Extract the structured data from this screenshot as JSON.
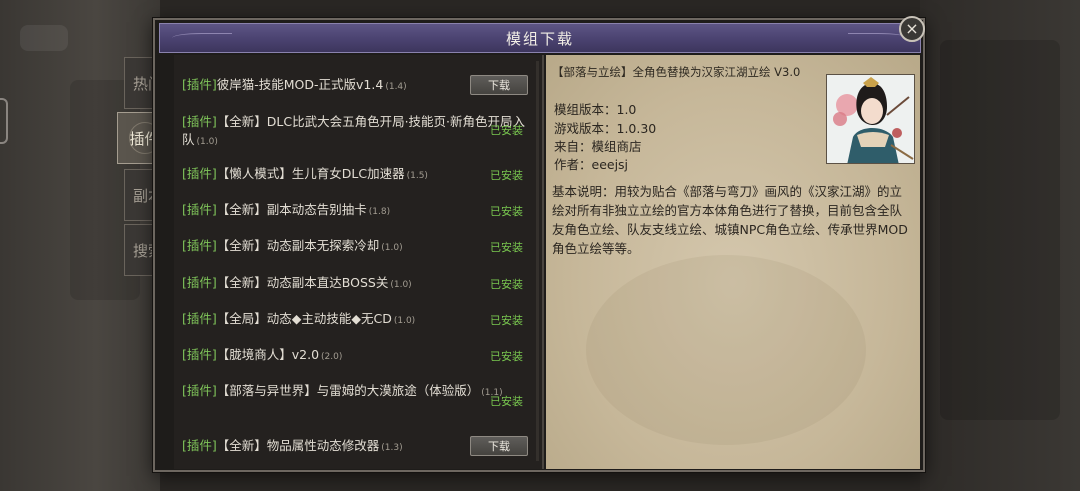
{
  "window": {
    "title": "模组下载",
    "close_glyph": "×"
  },
  "side_tabs": [
    {
      "label": "热门",
      "active": false
    },
    {
      "label": "插件",
      "active": true,
      "icon": "scroll-icon"
    },
    {
      "label": "副本",
      "active": false
    },
    {
      "label": "搜索",
      "active": false
    }
  ],
  "list": {
    "items": [
      {
        "tag": "[插件]",
        "name": "彼岸猫-技能MOD-正式版v1.4",
        "version": "(1.4)",
        "action": "下载"
      },
      {
        "tag": "[插件]",
        "name": "【全新】DLC比武大会五角色开局·技能页·新角色开局入队",
        "version": "(1.0)",
        "status": "已安装"
      },
      {
        "tag": "[插件]",
        "name": "【懒人模式】生儿育女DLC加速器",
        "version": "(1.5)",
        "status": "已安装"
      },
      {
        "tag": "[插件]",
        "name": "【全新】副本动态告别抽卡",
        "version": "(1.8)",
        "status": "已安装"
      },
      {
        "tag": "[插件]",
        "name": "【全新】动态副本无探索冷却",
        "version": "(1.0)",
        "status": "已安装"
      },
      {
        "tag": "[插件]",
        "name": "【全新】动态副本直达BOSS关",
        "version": "(1.0)",
        "status": "已安装"
      },
      {
        "tag": "[插件]",
        "name": "【全局】动态◆主动技能◆无CD",
        "version": "(1.0)",
        "status": "已安装"
      },
      {
        "tag": "[插件]",
        "name": "【胧境商人】v2.0",
        "version": "(2.0)",
        "status": "已安装"
      },
      {
        "tag": "[插件]",
        "name": "【部落与异世界】与雷姆的大漠旅途（体验版）",
        "version": "(1.1)",
        "status": "已安装"
      },
      {
        "tag": "[插件]",
        "name": "【全新】物品属性动态修改器",
        "version": "(1.3)",
        "action": "下载"
      }
    ]
  },
  "detail": {
    "title": "【部落与立绘】全角色替换为汉家江湖立绘 V3.0",
    "mod_version": "模组版本：1.0",
    "game_version": "游戏版本：1.0.30",
    "source": "来自：模组商店",
    "author": "作者：eeejsj",
    "description": "基本说明：用较为贴合《部落与弯刀》画风的《汉家江湖》的立绘对所有非独立立绘的官方本体角色进行了替换，目前包含全队友角色立绘、队友支线立绘、城镇NPC角色立绘、传承世界MOD角色立绘等等。",
    "portrait_icon": "character-portrait"
  }
}
